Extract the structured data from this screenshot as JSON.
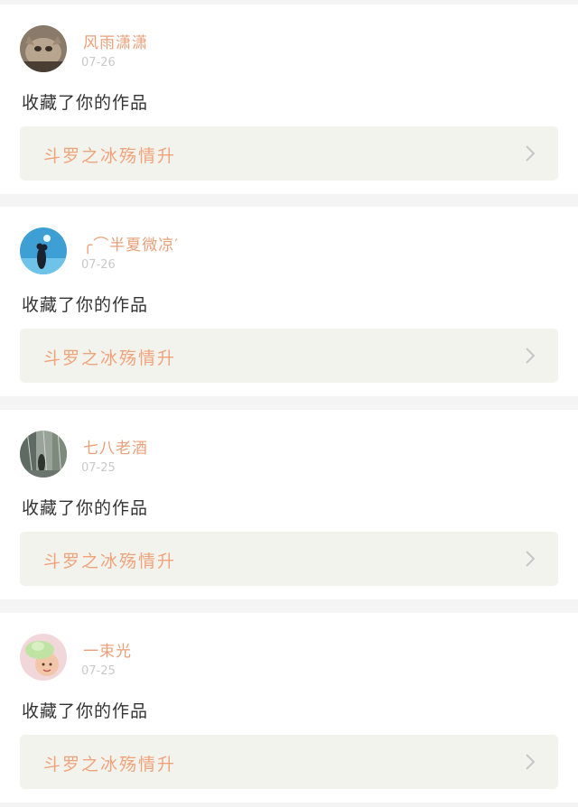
{
  "notifications": [
    {
      "username": "风雨潇潇",
      "date": "07-26",
      "action": "收藏了你的作品",
      "work_title": "斗罗之冰殇情升",
      "avatar_icon": "cat-photo-avatar"
    },
    {
      "username": "╭⌒半夏微凉′",
      "date": "07-26",
      "action": "收藏了你的作品",
      "work_title": "斗罗之冰殇情升",
      "avatar_icon": "couple-sea-avatar"
    },
    {
      "username": "七八老酒",
      "date": "07-25",
      "action": "收藏了你的作品",
      "work_title": "斗罗之冰殇情升",
      "avatar_icon": "rain-street-avatar"
    },
    {
      "username": "一束光",
      "date": "07-25",
      "action": "收藏了你的作品",
      "work_title": "斗罗之冰殇情升",
      "avatar_icon": "child-green-hat-avatar"
    }
  ],
  "colors": {
    "username": "#e9a07a",
    "work_title": "#f0a37b",
    "date": "#c9c9c9",
    "action_text": "#333333",
    "work_link_bg": "#f3f3ee",
    "page_bg": "#f4f4f4"
  }
}
